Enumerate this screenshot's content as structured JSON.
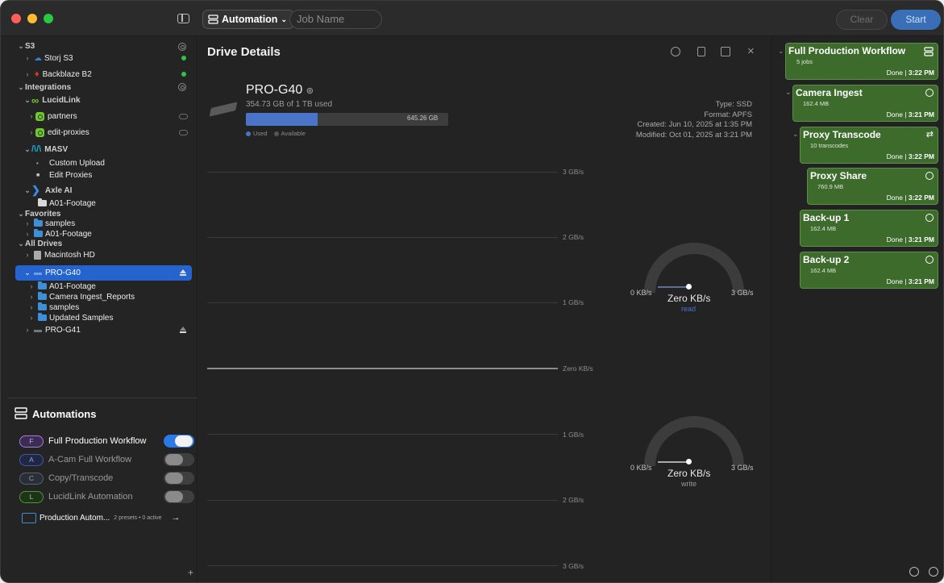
{
  "toolbar": {
    "automation_label": "Automation",
    "job_placeholder": "Job Name",
    "clear_label": "Clear",
    "start_label": "Start"
  },
  "sidebar": {
    "s3": "S3",
    "storj": "Storj S3",
    "backblaze": "Backblaze B2",
    "integrations": "Integrations",
    "lucidlink": "LucidLink",
    "partners": "partners",
    "edit_proxies": "edit-proxies",
    "masv": "MASV",
    "custom_upload": "Custom Upload",
    "edit_proxies_masv": "Edit Proxies",
    "axle": "Axle AI",
    "a01_axle": "A01-Footage",
    "favorites": "Favorites",
    "fav_samples": "samples",
    "fav_a01": "A01-Footage",
    "all_drives": "All Drives",
    "macintosh": "Macintosh HD",
    "pro_g40": "PRO-G40",
    "a01": "A01-Footage",
    "camera_ingest": "Camera Ingest_Reports",
    "samples": "samples",
    "updated_samples": "Updated Samples",
    "pro_g41": "PRO-G41"
  },
  "automations": {
    "title": "Automations",
    "items": [
      {
        "letter": "F",
        "name": "Full Production Workflow",
        "enabled": true,
        "color": "#a77be0"
      },
      {
        "letter": "A",
        "name": "A-Cam Full Workflow",
        "enabled": false,
        "color": "#5a7be0"
      },
      {
        "letter": "C",
        "name": "Copy/Transcode",
        "enabled": false,
        "color": "#8a9099"
      },
      {
        "letter": "L",
        "name": "LucidLink Automation",
        "enabled": false,
        "color": "#5fc43f"
      }
    ],
    "folder_name": "Production Autom...",
    "folder_meta": "2 presets • 0 active"
  },
  "drive": {
    "panel_title": "Drive Details",
    "name": "PRO-G40",
    "used_text": "354.73 GB of 1 TB used",
    "available_text": "645.26 GB",
    "used_fraction": 0.355,
    "legend_used": "Used",
    "legend_available": "Available",
    "type": "Type: SSD",
    "format": "Format: APFS",
    "created": "Created: Jun 10, 2025 at 1:35 PM",
    "modified": "Modified: Oct 01, 2025 at 3:21 PM"
  },
  "chart": {
    "labels": [
      "3 GB/s",
      "2 GB/s",
      "1 GB/s",
      "Zero KB/s",
      "1 GB/s",
      "2 GB/s",
      "3 GB/s"
    ]
  },
  "gauges": {
    "read": {
      "min": "0 KB/s",
      "max": "3 GB/s",
      "value": "Zero KB/s",
      "label": "read"
    },
    "write": {
      "min": "0 KB/s",
      "max": "3 GB/s",
      "value": "Zero KB/s",
      "label": "write"
    }
  },
  "workflow": [
    {
      "title": "Full Production Workflow",
      "sub": "5 jobs",
      "status": "Done",
      "time": "3:22 PM"
    },
    {
      "title": "Camera Ingest",
      "sub": "162.4 MB",
      "status": "Done",
      "time": "3:21 PM"
    },
    {
      "title": "Proxy Transcode",
      "sub": "10 transcodes",
      "status": "Done",
      "time": "3:22 PM"
    },
    {
      "title": "Proxy Share",
      "sub": "760.9 MB",
      "status": "Done",
      "time": "3:22 PM"
    },
    {
      "title": "Back-up 1",
      "sub": "162.4 MB",
      "status": "Done",
      "time": "3:21 PM"
    },
    {
      "title": "Back-up 2",
      "sub": "162.4 MB",
      "status": "Done",
      "time": "3:21 PM"
    }
  ],
  "colors": {
    "accent": "#2564cf",
    "card": "#3c6b2c",
    "status_green": "#31c14a"
  }
}
